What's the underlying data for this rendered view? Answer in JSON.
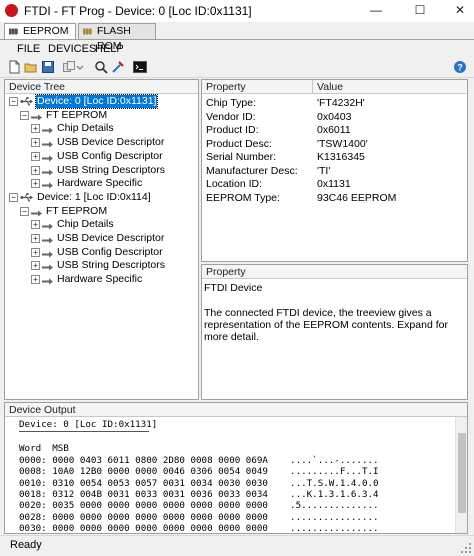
{
  "window": {
    "title": "FTDI - FT Prog - Device: 0 [Loc ID:0x1131]",
    "minimize": "—",
    "maximize": "☐",
    "close": "✕"
  },
  "tabs": [
    {
      "label": "EEPROM"
    },
    {
      "label": "FLASH ROM"
    }
  ],
  "menu": {
    "file": "FILE",
    "devices": "DEVICES",
    "help": "HELP"
  },
  "device_tree": {
    "header": "Device Tree",
    "devices": [
      {
        "label": "Device: 0 [Loc ID:0x1131]",
        "eeprom": "FT EEPROM",
        "children": [
          "Chip Details",
          "USB Device Descriptor",
          "USB Config Descriptor",
          "USB String Descriptors",
          "Hardware Specific"
        ]
      },
      {
        "label": "Device: 1 [Loc ID:0x114]",
        "eeprom": "FT EEPROM",
        "children": [
          "Chip Details",
          "USB Device Descriptor",
          "USB Config Descriptor",
          "USB String Descriptors",
          "Hardware Specific"
        ]
      }
    ]
  },
  "property_grid": {
    "col_property": "Property",
    "col_value": "Value",
    "rows": [
      {
        "name": "Chip Type:",
        "value": "'FT4232H'"
      },
      {
        "name": "Vendor ID:",
        "value": "0x0403"
      },
      {
        "name": "Product ID:",
        "value": "0x6011"
      },
      {
        "name": "Product Desc:",
        "value": "'TSW1400'"
      },
      {
        "name": "Serial Number:",
        "value": "K1316345"
      },
      {
        "name": "Manufacturer Desc:",
        "value": "'TI'"
      },
      {
        "name": "Location ID:",
        "value": "0x1131"
      },
      {
        "name": "EEPROM Type:",
        "value": "93C46 EEPROM"
      }
    ]
  },
  "property_desc": {
    "header": "Property",
    "title": "FTDI Device",
    "text": "The connected FTDI device, the treeview gives a representation of the EEPROM contents.  Expand for more detail."
  },
  "device_output": {
    "header": "Device Output",
    "device_line": "Device: 0 [Loc ID:0x1131]",
    "col_header": "Word  MSB",
    "lines": [
      "0000: 0000 0403 6011 0800 2D80 0008 0000 069A    ....`...-.......",
      "0008: 10A0 12B0 0000 0000 0046 0306 0054 0049    .........F...T.I",
      "0010: 0310 0054 0053 0057 0031 0034 0030 0030    ...T.S.W.1.4.0.0",
      "0018: 0312 004B 0031 0033 0031 0036 0033 0034    ...K.1.3.1.6.3.4",
      "0020: 0035 0000 0000 0000 0000 0000 0000 0000    .5..............",
      "0028: 0000 0000 0000 0000 0000 0000 0000 0000    ................",
      "0030: 0000 0000 0000 0000 0000 0000 0000 0000    ................"
    ]
  },
  "status": {
    "text": "Ready"
  },
  "colors": {
    "selection": "#0078d7",
    "app_icon": "#c9141c",
    "help_icon": "#2b73c9"
  }
}
